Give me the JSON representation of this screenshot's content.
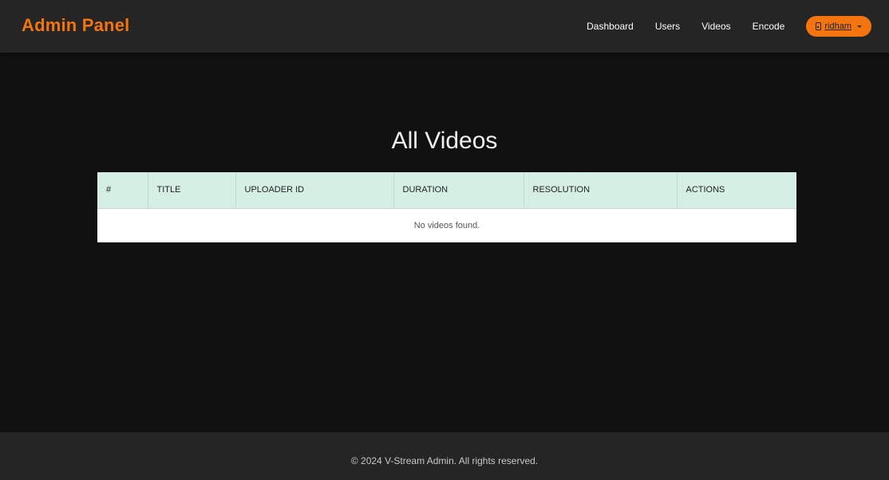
{
  "navbar": {
    "brand": "Admin Panel",
    "links": [
      "Dashboard",
      "Users",
      "Videos",
      "Encode"
    ],
    "user": {
      "name": "ridham"
    }
  },
  "main": {
    "title": "All Videos",
    "table": {
      "columns": [
        "#",
        "TITLE",
        "UPLOADER ID",
        "DURATION",
        "RESOLUTION",
        "ACTIONS"
      ],
      "empty_message": "No videos found."
    }
  },
  "footer": {
    "text": "© 2024 V-Stream Admin. All rights reserved."
  },
  "colors": {
    "accent": "#f4750f",
    "background": "#111111",
    "header_background": "#252525",
    "table_header": "#d6efe5"
  },
  "icons": {
    "user": "user-icon"
  }
}
